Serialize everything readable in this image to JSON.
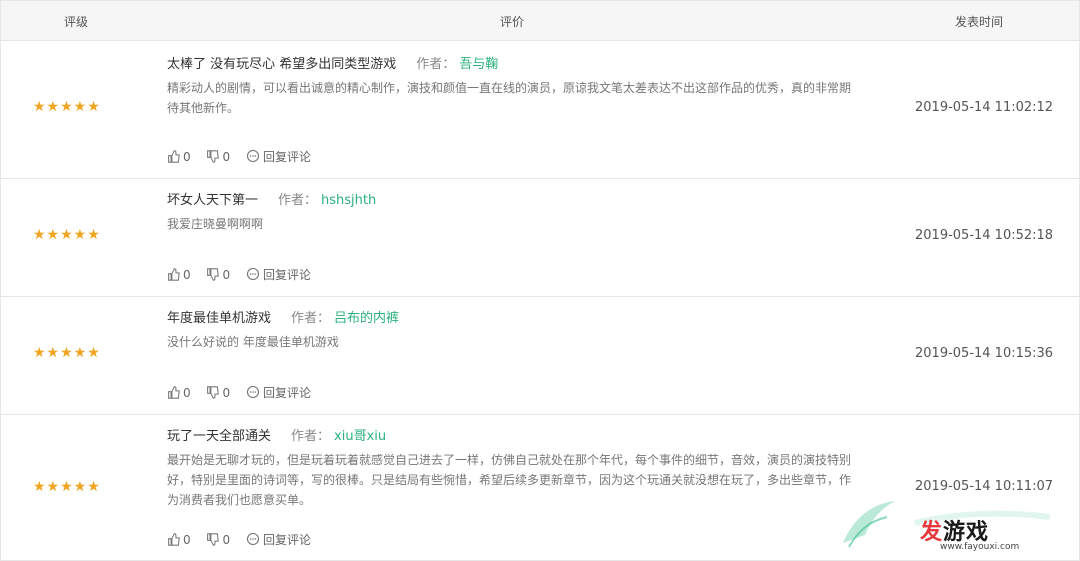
{
  "header": {
    "rating": "评级",
    "review": "评价",
    "time": "发表时间"
  },
  "labels": {
    "author": "作者：",
    "reply": "回复评论"
  },
  "colors": {
    "star": "#f0a420",
    "author": "#2bb27c",
    "watermark_red": "#e8383d"
  },
  "reviews": [
    {
      "stars": "★★★★★",
      "title": "太棒了 没有玩尽心 希望多出同类型游戏",
      "author": "吾与鞠",
      "content": "精彩动人的剧情，可以看出诚意的精心制作，演技和颜值一直在线的演员，原谅我文笔太差表达不出这部作品的优秀，真的非常期待其他新作。",
      "likes": "0",
      "dislikes": "0",
      "time": "2019-05-14 11:02:12"
    },
    {
      "stars": "★★★★★",
      "title": "坏女人天下第一",
      "author": "hshsjhth",
      "content": "我爱庄晓曼啊啊啊",
      "likes": "0",
      "dislikes": "0",
      "time": "2019-05-14 10:52:18"
    },
    {
      "stars": "★★★★★",
      "title": "年度最佳单机游戏",
      "author": "吕布的内裤",
      "content": "没什么好说的 年度最佳单机游戏",
      "likes": "0",
      "dislikes": "0",
      "time": "2019-05-14 10:15:36"
    },
    {
      "stars": "★★★★★",
      "title": "玩了一天全部通关",
      "author": "xiu哥xiu",
      "content": "最开始是无聊才玩的，但是玩着玩着就感觉自己进去了一样，仿佛自己就处在那个年代，每个事件的细节，音效，演员的演技特别好，特别是里面的诗词等，写的很棒。只是结局有些惋惜，希望后续多更新章节，因为这个玩通关就没想在玩了，多出些章节，作为消费者我们也愿意买单。",
      "likes": "0",
      "dislikes": "0",
      "time": "2019-05-14 10:11:07"
    }
  ],
  "watermark": {
    "red": "发",
    "black": "游戏",
    "url": "www.fayouxi.com"
  }
}
